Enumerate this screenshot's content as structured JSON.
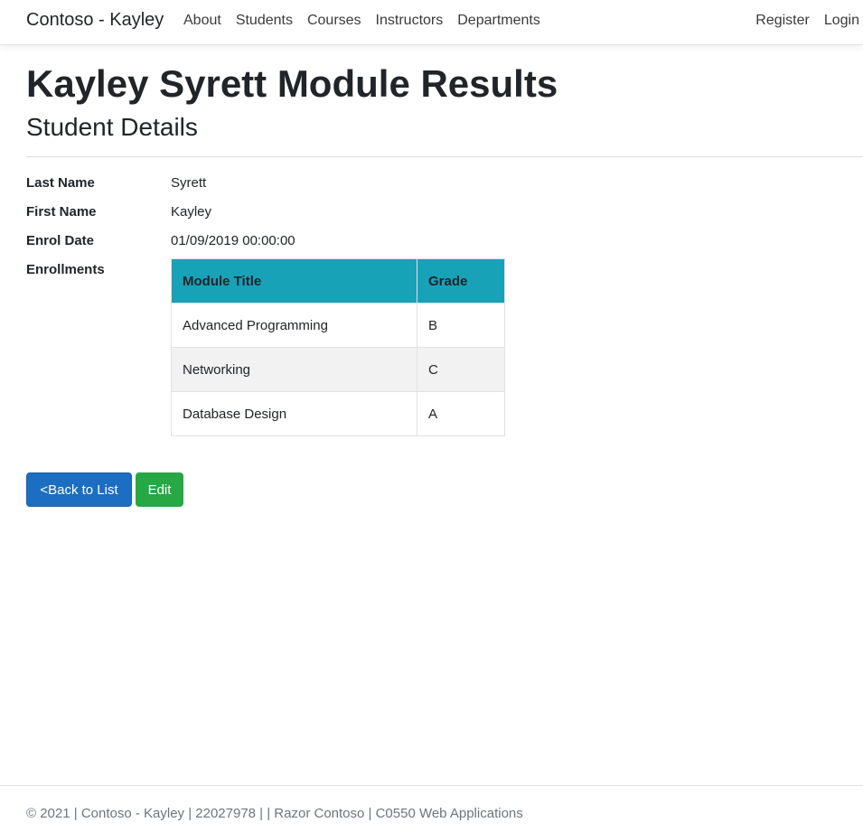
{
  "nav": {
    "brand": "Contoso - Kayley",
    "links": [
      "About",
      "Students",
      "Courses",
      "Instructors",
      "Departments"
    ],
    "right_links": [
      "Register",
      "Login"
    ]
  },
  "page": {
    "title": "Kayley Syrett Module Results",
    "subtitle": "Student Details"
  },
  "details": {
    "last_name_label": "Last Name",
    "last_name": "Syrett",
    "first_name_label": "First Name",
    "first_name": "Kayley",
    "enrol_date_label": "Enrol Date",
    "enrol_date": "01/09/2019 00:00:00",
    "enrollments_label": "Enrollments"
  },
  "enrollments": {
    "headers": [
      "Module Title",
      "Grade"
    ],
    "rows": [
      [
        "Advanced Programming",
        "B"
      ],
      [
        "Networking",
        "C"
      ],
      [
        "Database Design",
        "A"
      ]
    ]
  },
  "actions": {
    "back_label": "<Back to List",
    "edit_label": "Edit"
  },
  "footer": {
    "text": "© 2021 | Contoso - Kayley | 22027978 | | Razor Contoso | C0550 Web Applications"
  },
  "colors": {
    "table_header": "#17a2b8",
    "primary": "#1b6ec2",
    "success": "#28a745"
  }
}
